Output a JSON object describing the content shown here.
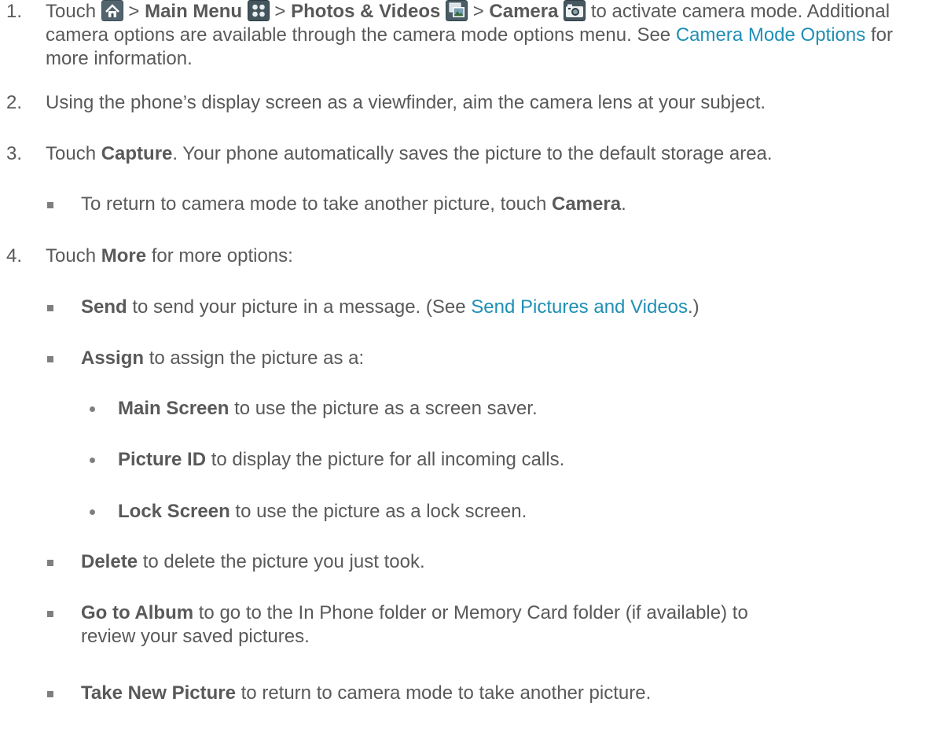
{
  "steps": [
    {
      "number": "1.",
      "touch": "Touch",
      "sep": ">",
      "main_menu": "Main Menu",
      "photos_videos": "Photos & Videos",
      "camera": "Camera",
      "text_after": "to activate camera mode. Additional camera options are available through the camera mode options menu. See",
      "link": "Camera Mode Options",
      "text_end": "for more information."
    },
    {
      "number": "2.",
      "text": "Using the phone’s display screen as a viewfinder, aim the camera lens at your subject."
    },
    {
      "number": "3.",
      "touch": "Touch",
      "capture": "Capture",
      "text_after": ". Your phone automatically saves the picture to the default storage area.",
      "sub": {
        "text": "To return to camera mode to take another picture, touch",
        "bold": "Camera",
        "end": "."
      }
    },
    {
      "number": "4.",
      "touch": "Touch",
      "more": "More",
      "text_after": "for more options:"
    }
  ],
  "options": [
    {
      "bold": "Send",
      "text": "to send your picture in a message. (See",
      "link": "Send Pictures and Videos",
      "end": ".)"
    },
    {
      "bold": "Assign",
      "text": "to assign the picture as a:"
    },
    {
      "bold": "Delete",
      "text": "to delete the picture you just took."
    },
    {
      "bold": "Go to Album",
      "text": "to go to the In Phone folder or Memory Card folder (if available) to",
      "text2": "review your saved pictures."
    },
    {
      "bold": "Take New Picture",
      "text": "to return to camera mode to take another picture."
    }
  ],
  "assign_options": [
    {
      "bold": "Main Screen",
      "text": "to use the picture as a screen saver."
    },
    {
      "bold": "Picture ID",
      "text": "to display the picture for all incoming calls."
    },
    {
      "bold": "Lock Screen",
      "text": "to use the picture as a lock screen."
    }
  ],
  "icons": [
    "home-icon",
    "main-menu-icon",
    "photos-videos-icon",
    "camera-icon"
  ]
}
